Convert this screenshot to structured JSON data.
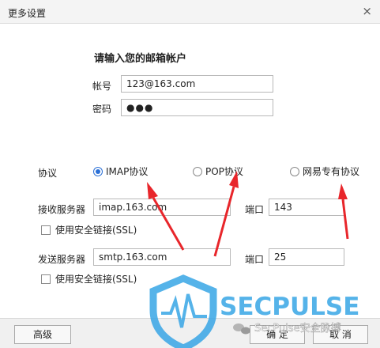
{
  "window": {
    "title": "更多设置",
    "close_icon": "×"
  },
  "form": {
    "heading": "请输入您的邮箱帐户",
    "account_label": "帐号",
    "account_value": "123@163.com",
    "password_label": "密码",
    "password_value": "●●●"
  },
  "protocol": {
    "label": "协议",
    "options": [
      {
        "label": "IMAP协议",
        "selected": true
      },
      {
        "label": "POP协议",
        "selected": false
      },
      {
        "label": "网易专有协议",
        "selected": false
      }
    ]
  },
  "receive": {
    "server_label": "接收服务器",
    "server_value": "imap.163.com",
    "port_label": "端口",
    "port_value": "143",
    "ssl_label": "使用安全链接(SSL)"
  },
  "send": {
    "server_label": "发送服务器",
    "server_value": "smtp.163.com",
    "port_label": "端口",
    "port_value": "25",
    "ssl_label": "使用安全链接(SSL)"
  },
  "footer": {
    "advanced": "高级",
    "ok": "确 定",
    "cancel": "取 消"
  },
  "watermark": {
    "brand": "SECPULSE",
    "caption": "SecPulse安全脉搏"
  },
  "colors": {
    "accent": "#2a6fd6",
    "arrow": "#e8262b",
    "watermark": "#38a6e6"
  }
}
